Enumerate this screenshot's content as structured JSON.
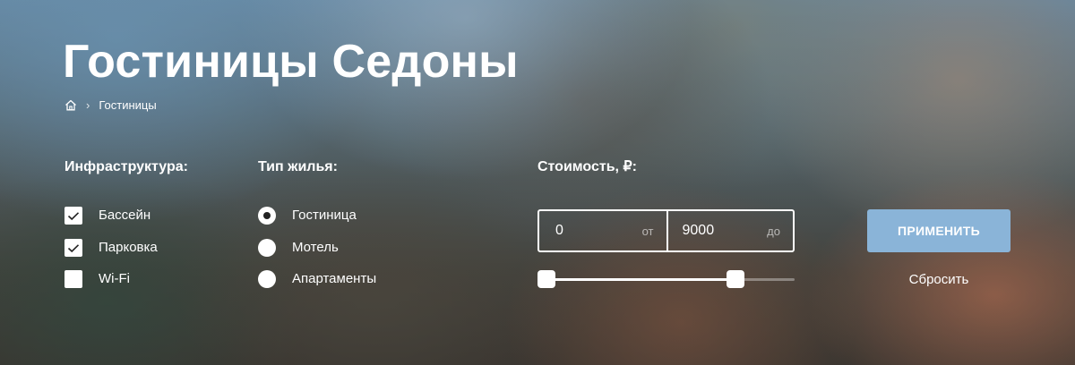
{
  "colors": {
    "accent_button": "#8ab4d8",
    "text": "#ffffff",
    "control_bg": "#ffffff",
    "check_mark": "#222222"
  },
  "page": {
    "title": "Гостиницы Седоны"
  },
  "breadcrumb": {
    "home_icon": "home-icon",
    "separator_icon": "chevron-right-icon",
    "separator": "›",
    "current": "Гостиницы"
  },
  "filters": {
    "infrastructure": {
      "title": "Инфраструктура:",
      "options": [
        {
          "label": "Бассейн",
          "checked": true
        },
        {
          "label": "Парковка",
          "checked": true
        },
        {
          "label": "Wi-Fi",
          "checked": false
        }
      ]
    },
    "housing_type": {
      "title": "Тип жилья:",
      "options": [
        {
          "label": "Гостиница",
          "selected": true
        },
        {
          "label": "Мотель",
          "selected": false
        },
        {
          "label": "Апартаменты",
          "selected": false
        }
      ]
    },
    "price": {
      "title": "Стоимость, ₽:",
      "min_value": "0",
      "min_suffix": "от",
      "max_value": "9000",
      "max_suffix": "до",
      "slider_min_fraction": 0.0,
      "slider_max_fraction": 0.79
    }
  },
  "actions": {
    "apply_label": "ПРИМЕНИТЬ",
    "reset_label": "Сбросить"
  }
}
